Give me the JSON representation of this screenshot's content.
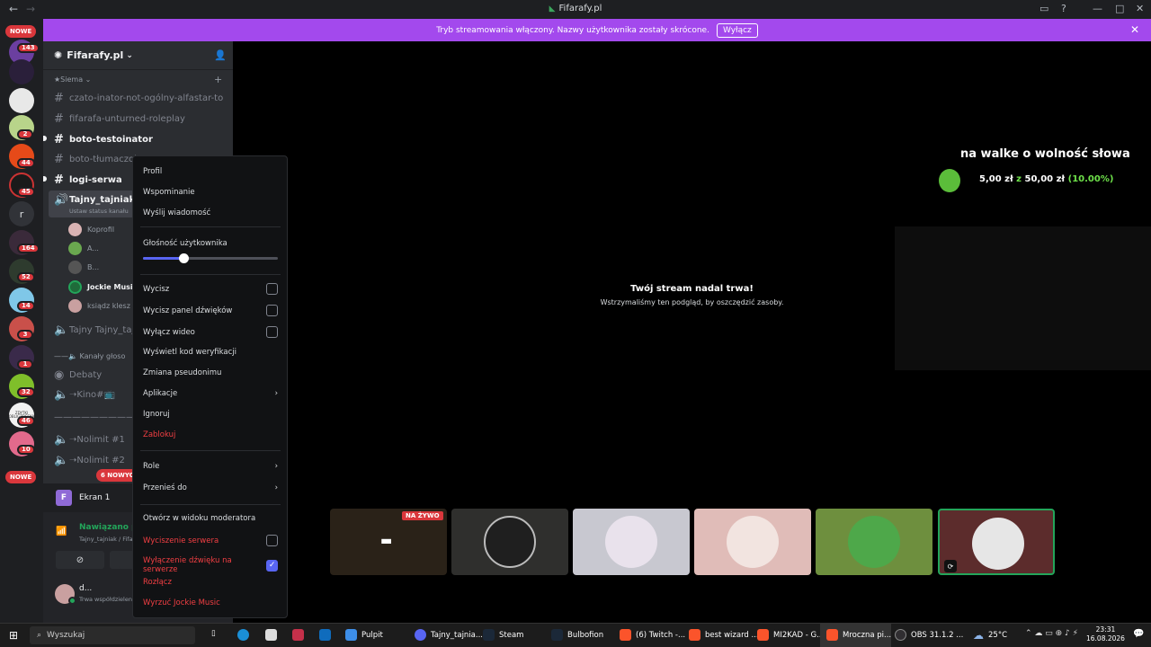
{
  "window": {
    "title": "Fifarafy.pl",
    "back": "←",
    "forward": "→"
  },
  "banner": {
    "text": "Tryb streamowania włączony. Nazwy użytkownika zostały skrócone.",
    "button": "Wyłącz",
    "close": "✕"
  },
  "rail": {
    "nowe_top": "NOWE",
    "nowe_bottom": "NOWE",
    "badges": [
      "143",
      "2",
      "44",
      "45",
      "164",
      "52",
      "14",
      "3",
      "1",
      "32",
      "46",
      "10"
    ],
    "letter": "r",
    "thumb_texts": [
      "ZDYTKI OBLIGZDESKA"
    ]
  },
  "server": {
    "name": "Fifarafy.pl",
    "category": "Siema",
    "channels": [
      "czato-inator-not-ogólny-alfastar-to",
      "fifarafa-unturned-roleplay",
      "boto-testoinator",
      "boto-tłumaczoi",
      "logi-serwa"
    ],
    "voice_channel": "Tajny_tajniak",
    "voice_status": "Ustaw status kanału",
    "voice_users": [
      "Koprofil",
      "A...",
      "B...",
      "Jockie Music",
      "ksiądz klesz"
    ],
    "channel2": "Tajny Tajny_taj",
    "voice_cat": "Kanały głoso",
    "debaty": "Debaty",
    "kino": "➝Kino#📺",
    "divider1": "——————————",
    "nolimit1": "➝Nolimit #1",
    "nolimit2": "➝Nolimit #2",
    "new_msgs": "6 NOWYCH"
  },
  "panel": {
    "stream_name": "Ekran 1",
    "connected": "Nawiązano połączenie",
    "connected_sub": "Tajny_tajniak / Fifarafy.pl",
    "user": "d...",
    "user_status": "Trwa współdzielenie ekr..."
  },
  "context_menu": {
    "profil": "Profil",
    "wspominanie": "Wspominanie",
    "wyslij": "Wyślij wiadomość",
    "glosnosc": "Głośność użytkownika",
    "wycisz": "Wycisz",
    "wycisz_panel": "Wycisz panel dźwięków",
    "wylacz_wideo": "Wyłącz wideo",
    "kod": "Wyświetl kod weryfikacji",
    "pseudonim": "Zmiana pseudonimu",
    "aplikacje": "Aplikacje",
    "ignoruj": "Ignoruj",
    "zablokuj": "Zablokuj",
    "role": "Role",
    "przenies": "Przenieś do",
    "moderator": "Otwórz w widoku moderatora",
    "wyciszenie": "Wyciszenie serwera",
    "wylaczenie": "Wyłączenie dźwięku na serwerze",
    "rozlacz": "Rozłącz",
    "wyrzuc": "Wyrzuć Jockie Music",
    "volume_fraction": 0.3
  },
  "stream": {
    "goal_title": "na walke o wolność słowa",
    "goal_amount": "5,00 zł",
    "goal_z": "z",
    "goal_target": "50,00 zł",
    "goal_pct": "(10.00%)",
    "paused_title": "Twój stream nadal trwa!",
    "paused_sub": "Wstrzymaliśmy ten podgląd, by oszczędzić zasoby.",
    "live": "NA ŻYWO"
  },
  "taskbar": {
    "search": "Wyszukaj",
    "items": [
      "Pulpit",
      "Tajny_tajnia...",
      "Steam",
      "Bulbofion",
      "(6) Twitch -...",
      "best wizard ...",
      "MI2KAD - G...",
      "Mroczna pi...",
      "OBS 31.1.2 ..."
    ],
    "temp": "25°C",
    "time": "23:31",
    "date": "16.08.2026"
  }
}
